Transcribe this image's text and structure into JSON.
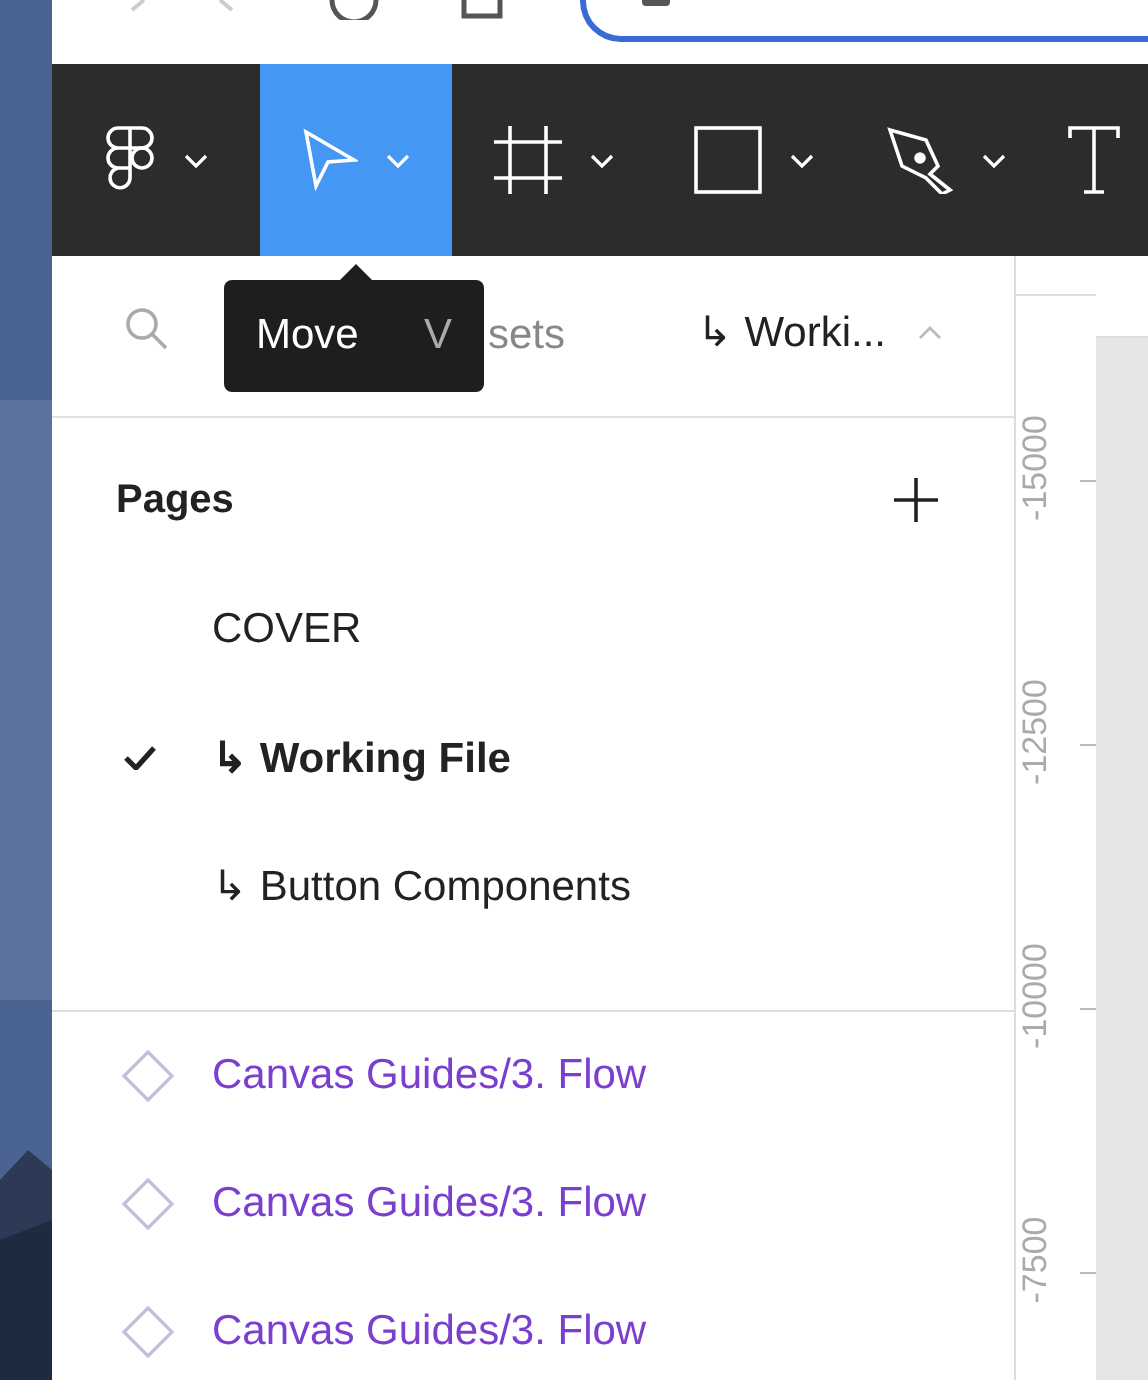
{
  "toolbar": {
    "tools": [
      {
        "kind": "menu",
        "selected": false
      },
      {
        "kind": "move",
        "selected": true
      },
      {
        "kind": "frame",
        "selected": false
      },
      {
        "kind": "rect",
        "selected": false
      },
      {
        "kind": "pen",
        "selected": false
      },
      {
        "kind": "text",
        "selected": false
      }
    ]
  },
  "tooltip": {
    "label": "Move",
    "shortcut": "V"
  },
  "panel_tabs": [
    {
      "label": "sets"
    }
  ],
  "page_selector": {
    "label": "↳ Worki..."
  },
  "pages": {
    "title": "Pages",
    "items": [
      {
        "label": "COVER",
        "selected": false
      },
      {
        "label": "↳ Working File",
        "selected": true
      },
      {
        "label": "↳ Button Components",
        "selected": false
      }
    ]
  },
  "layers": [
    {
      "label": "Canvas Guides/3. Flow"
    },
    {
      "label": "Canvas Guides/3. Flow"
    },
    {
      "label": "Canvas Guides/3. Flow"
    }
  ],
  "ruler": {
    "labels": [
      "-15000",
      "-12500",
      "-10000",
      "-7500"
    ]
  }
}
